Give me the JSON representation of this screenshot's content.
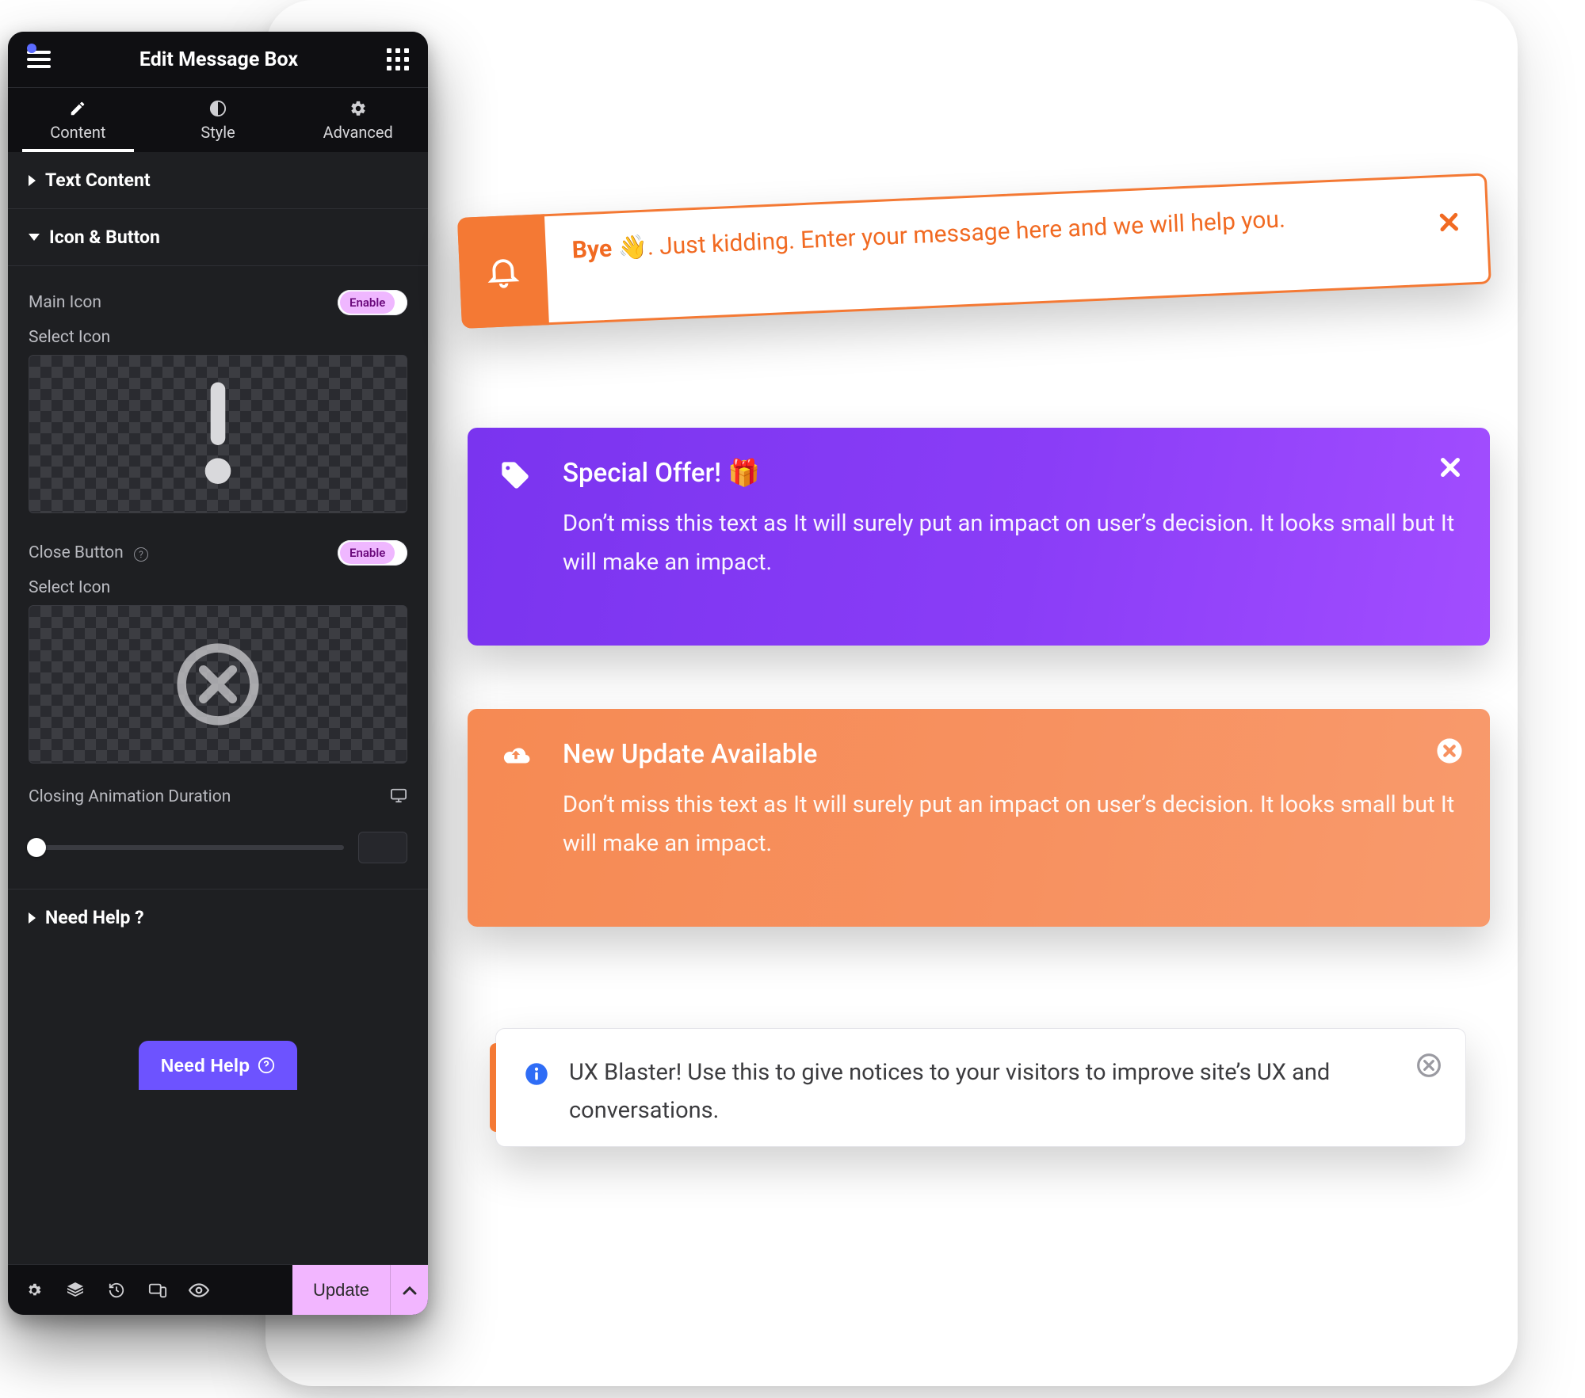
{
  "panel": {
    "title": "Edit Message Box",
    "tabs": {
      "content": "Content",
      "style": "Style",
      "advanced": "Advanced"
    },
    "sections": {
      "text_content": "Text Content",
      "icon_button": "Icon & Button",
      "need_help": "Need Help ?"
    },
    "fields": {
      "main_icon_label": "Main Icon",
      "main_icon_toggle": "Enable",
      "select_icon_1": "Select Icon",
      "close_button_label": "Close Button",
      "close_button_toggle": "Enable",
      "select_icon_2": "Select Icon",
      "closing_anim_label": "Closing Animation Duration"
    },
    "help_btn": "Need Help",
    "footer": {
      "update": "Update"
    }
  },
  "messages": {
    "m1": {
      "bold": "Bye",
      "emoji": "👋",
      "rest": ". Just kidding. Enter your message here and we will help you."
    },
    "m2": {
      "title": "Special Offer!",
      "emoji": "🎁",
      "body": "Don’t miss this text as It will surely put an impact on user’s decision. It looks small but It will make an impact."
    },
    "m3": {
      "title": "New Update Available",
      "body": "Don’t miss this text as It will surely put an impact on user’s decision. It looks small but It will make an impact."
    },
    "m4": {
      "text": "UX Blaster! Use this to give notices to your visitors to improve site’s UX and conversations."
    }
  }
}
